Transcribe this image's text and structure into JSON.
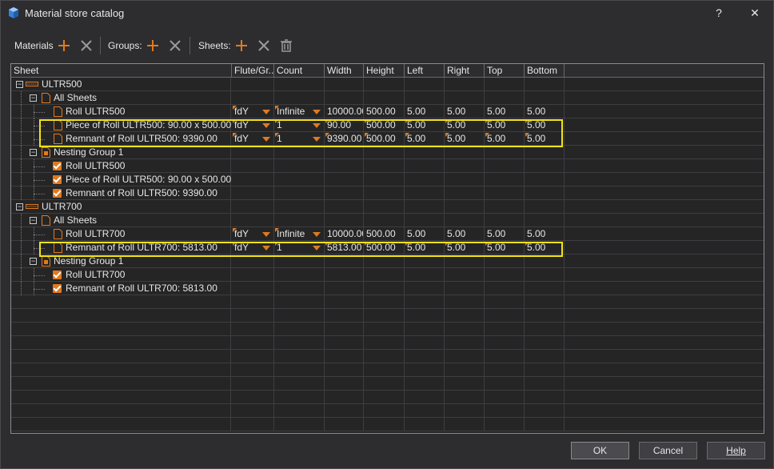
{
  "window": {
    "title": "Material store catalog",
    "help_glyph": "?",
    "close_glyph": "✕"
  },
  "toolbar": {
    "materials_label": "Materials",
    "groups_label": "Groups:",
    "sheets_label": "Sheets:"
  },
  "columns": [
    "Sheet",
    "Flute/Gr...",
    "Count",
    "Width",
    "Height",
    "Left",
    "Right",
    "Top",
    "Bottom"
  ],
  "tree": [
    {
      "kind": "material",
      "label": "ULTR500"
    },
    {
      "kind": "folder",
      "label": "All Sheets"
    },
    {
      "kind": "sheet",
      "label": "Roll ULTR500",
      "flute": "fdY",
      "count": "Infinite",
      "width": "10000.00",
      "height": "500.00",
      "left": "5.00",
      "right": "5.00",
      "top": "5.00",
      "bottom": "5.00",
      "editable": false
    },
    {
      "kind": "sheet",
      "label": "Piece of Roll ULTR500: 90.00 x 500.00",
      "flute": "fdY",
      "count": "1",
      "width": "90.00",
      "height": "500.00",
      "left": "5.00",
      "right": "5.00",
      "top": "5.00",
      "bottom": "5.00",
      "editable": true
    },
    {
      "kind": "sheet",
      "label": "Remnant of Roll ULTR500: 9390.00",
      "flute": "fdY",
      "count": "1",
      "width": "9390.00",
      "height": "500.00",
      "left": "5.00",
      "right": "5.00",
      "top": "5.00",
      "bottom": "5.00",
      "editable": true
    },
    {
      "kind": "group",
      "label": "Nesting Group 1"
    },
    {
      "kind": "check",
      "label": "Roll ULTR500"
    },
    {
      "kind": "check",
      "label": "Piece of Roll ULTR500: 90.00 x 500.00"
    },
    {
      "kind": "check",
      "label": "Remnant of Roll ULTR500: 9390.00"
    },
    {
      "kind": "material",
      "label": "ULTR700"
    },
    {
      "kind": "folder",
      "label": "All Sheets"
    },
    {
      "kind": "sheet",
      "label": "Roll ULTR700",
      "flute": "fdY",
      "count": "Infinite",
      "width": "10000.00",
      "height": "500.00",
      "left": "5.00",
      "right": "5.00",
      "top": "5.00",
      "bottom": "5.00",
      "editable": false
    },
    {
      "kind": "sheet",
      "label": "Remnant of Roll ULTR700: 5813.00",
      "flute": "fdY",
      "count": "1",
      "width": "5813.00",
      "height": "500.00",
      "left": "5.00",
      "right": "5.00",
      "top": "5.00",
      "bottom": "5.00",
      "editable": true
    },
    {
      "kind": "group",
      "label": "Nesting Group 1"
    },
    {
      "kind": "check",
      "label": "Roll ULTR700"
    },
    {
      "kind": "check",
      "label": "Remnant of Roll ULTR700: 5813.00"
    }
  ],
  "buttons": {
    "ok": "OK",
    "cancel": "Cancel",
    "help": "Help"
  },
  "colors": {
    "accent": "#e07a1f",
    "highlight": "#f2e21a",
    "background": "#2d2d30"
  }
}
